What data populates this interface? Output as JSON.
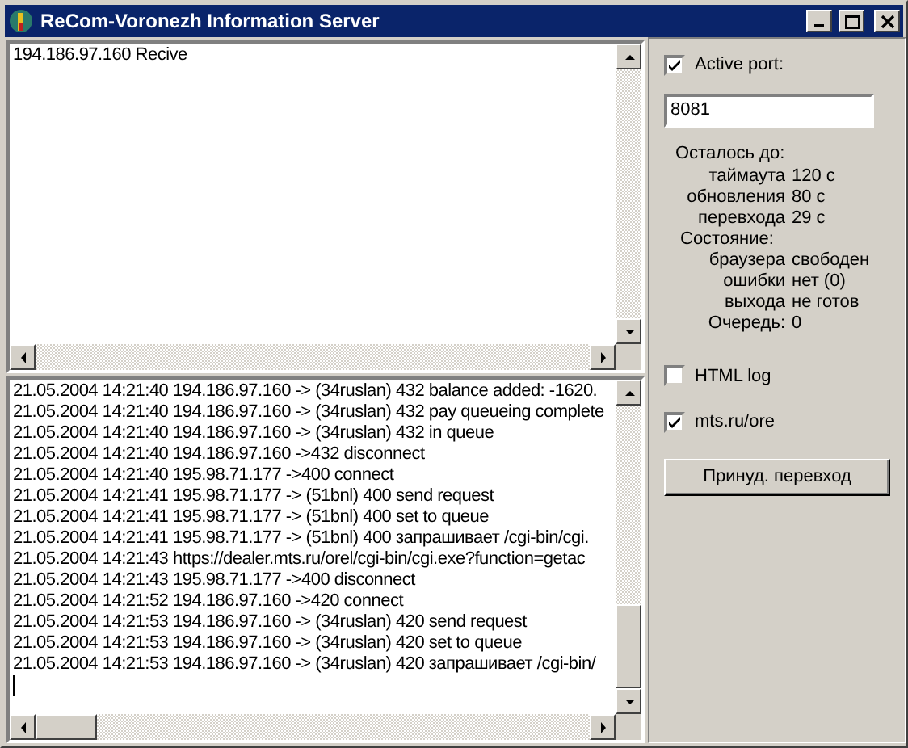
{
  "window": {
    "title": "ReCom-Voronezh Information Server"
  },
  "top_log": {
    "lines": [
      "194.186.97.160 Recive"
    ]
  },
  "bottom_log": {
    "lines": [
      "21.05.2004 14:21:40 194.186.97.160 -> (34ruslan) 432 balance added: -1620.",
      "21.05.2004 14:21:40 194.186.97.160 -> (34ruslan) 432 pay queueing complete",
      "21.05.2004 14:21:40 194.186.97.160 -> (34ruslan) 432 in queue",
      "21.05.2004 14:21:40 194.186.97.160 ->432 disconnect",
      "21.05.2004 14:21:40 195.98.71.177 ->400 connect",
      "21.05.2004 14:21:41 195.98.71.177 -> (51bnl) 400 send request",
      "21.05.2004 14:21:41 195.98.71.177 -> (51bnl) 400 set to queue",
      "21.05.2004 14:21:41 195.98.71.177 -> (51bnl) 400 запрашивает /cgi-bin/cgi.",
      "21.05.2004 14:21:43 https://dealer.mts.ru/orel/cgi-bin/cgi.exe?function=getac",
      "21.05.2004 14:21:43 195.98.71.177 ->400 disconnect",
      "21.05.2004 14:21:52 194.186.97.160 ->420 connect",
      "21.05.2004 14:21:53 194.186.97.160 -> (34ruslan) 420 send request",
      "21.05.2004 14:21:53 194.186.97.160 -> (34ruslan) 420 set to queue",
      "21.05.2004 14:21:53 194.186.97.160 -> (34ruslan) 420 запрашивает /cgi-bin/"
    ]
  },
  "active_port": {
    "label": "Active port:",
    "checked": true,
    "value": "8081"
  },
  "status": [
    {
      "kind": "heading",
      "label": "Осталось до:"
    },
    {
      "kind": "row",
      "label": "таймаута",
      "value": "120 с"
    },
    {
      "kind": "row",
      "label": "обновления",
      "value": "80 с"
    },
    {
      "kind": "row",
      "label": "перевхода",
      "value": "29 с"
    },
    {
      "kind": "subheading",
      "label": "Состояние:"
    },
    {
      "kind": "row",
      "label": "браузера",
      "value": "свободен"
    },
    {
      "kind": "row",
      "label": "ошибки",
      "value": "нет (0)"
    },
    {
      "kind": "row",
      "label": "выхода",
      "value": "не готов"
    },
    {
      "kind": "row",
      "label": "Очередь:",
      "value": "0"
    }
  ],
  "options": [
    {
      "label": "HTML log",
      "checked": false
    },
    {
      "label": "mts.ru/ore",
      "checked": true
    }
  ],
  "button": {
    "label": "Принуд. перевход"
  }
}
